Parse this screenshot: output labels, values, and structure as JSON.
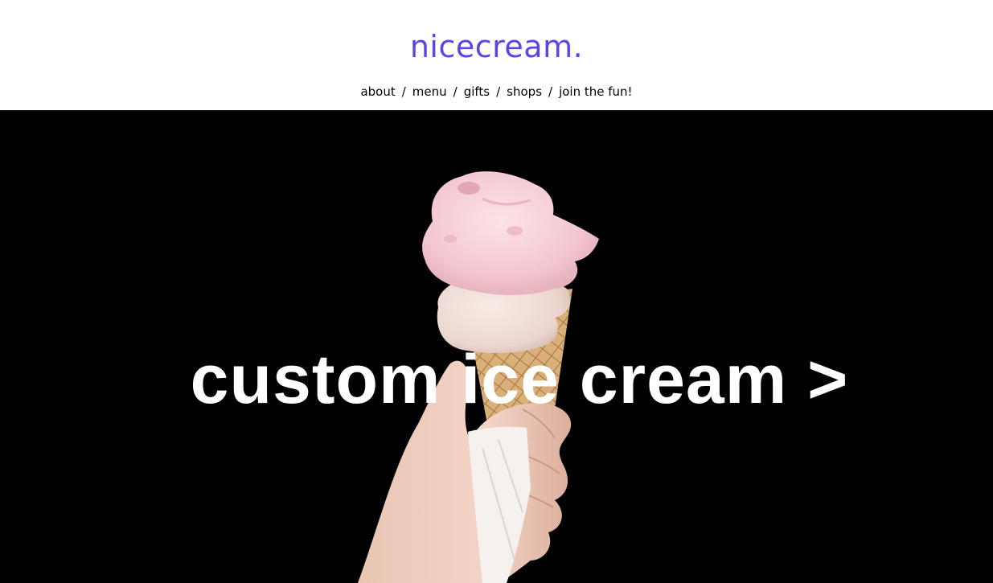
{
  "header": {
    "brand": "nicecream.",
    "nav": [
      {
        "label": "about"
      },
      {
        "label": "menu"
      },
      {
        "label": "gifts"
      },
      {
        "label": "shops"
      },
      {
        "label": "join the fun!"
      }
    ],
    "separator": "/"
  },
  "hero": {
    "cta": "custom ice cream >"
  },
  "colors": {
    "brand": "#5a45e8",
    "hero_background": "#000000",
    "cta_text": "#ffffff"
  }
}
